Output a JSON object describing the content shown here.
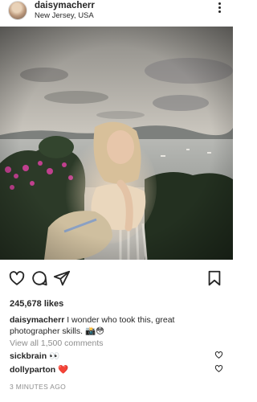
{
  "post": {
    "username": "daisymacherr",
    "location": "New Jersey, USA",
    "likes": "245,678 likes",
    "caption_user": "daisymacherr",
    "caption_text": "I wonder who took this, great photographer skills. 📸😳",
    "view_comments": "View all 1,500 comments",
    "comments": [
      {
        "user": "sickbrain",
        "text": "👀"
      },
      {
        "user": "dollyparton",
        "text": "❤️"
      }
    ],
    "timestamp": "3 MINUTES AGO"
  },
  "icons": {
    "more": "more-vertical-icon",
    "like": "heart-icon",
    "comment": "comment-bubble-icon",
    "share": "paper-plane-icon",
    "save": "bookmark-icon"
  },
  "colors": {
    "text": "#262626",
    "muted": "#8e8e8e",
    "heart": "#ed4956"
  }
}
